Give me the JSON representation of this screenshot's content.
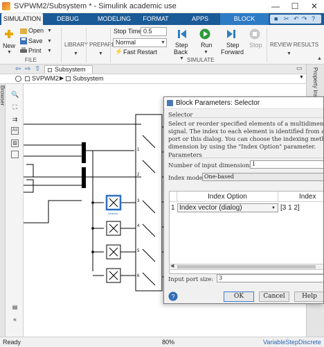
{
  "window": {
    "title": "SVPWM2/Subsystem * - Simulink academic use",
    "minimize": "—",
    "maximize": "☐",
    "close": "✕"
  },
  "tabs": [
    "SIMULATION",
    "DEBUG",
    "MODELING",
    "FORMAT",
    "APPS",
    "BLOCK"
  ],
  "ribbon": {
    "new": "New",
    "open": "Open",
    "save": "Save",
    "print": "Print",
    "file_group": "FILE",
    "library": "LIBRARY",
    "prepare": "PREPARE",
    "stop_time_label": "Stop Time",
    "stop_time_value": "0.5",
    "mode": "Normal",
    "fast_restart": "Fast Restart",
    "step_back": [
      "Step",
      "Back"
    ],
    "run": "Run",
    "step_forward": [
      "Step",
      "Forward"
    ],
    "stop": "Stop",
    "simulate_group": "SIMULATE",
    "review_results": "REVIEW RESULTS"
  },
  "breadcrumb_tab": "Subsystem",
  "breadcrumb": [
    "SVPWM2",
    "Subsystem"
  ],
  "left_panel": "Model Browser",
  "right_panel": [
    "Property Inspector"
  ],
  "canvas": {
    "port_labels": [
      "1",
      "2",
      "3",
      "4",
      "5",
      "6"
    ],
    "selected_block_label": "Selector"
  },
  "status": {
    "ready": "Ready",
    "zoom": "80%",
    "solver": "VariableStepDiscrete"
  },
  "dialog": {
    "title": "Block Parameters: Selector",
    "section_selector": "Selector",
    "description_lines": [
      "Select or reorder specified elements of a multidimensional",
      "signal. The index to each element is identified from an input",
      "port or this dialog. You can choose the indexing method for each",
      "dimension by using the \"Index Option\" parameter."
    ],
    "section_parameters": "Parameters",
    "num_dims_label": "Number of input dimensions:",
    "num_dims_value": "1",
    "index_mode_label": "Index mode:",
    "index_mode_value": "One-based",
    "table": {
      "headers": [
        "Index Option",
        "Index"
      ],
      "rows": [
        {
          "num": "1",
          "option": "Index vector (dialog)",
          "index": "[3 1 2]"
        }
      ]
    },
    "port_size_label": "Input port size:",
    "port_size_value": "3",
    "buttons": {
      "ok": "OK",
      "cancel": "Cancel",
      "help": "Help"
    }
  }
}
